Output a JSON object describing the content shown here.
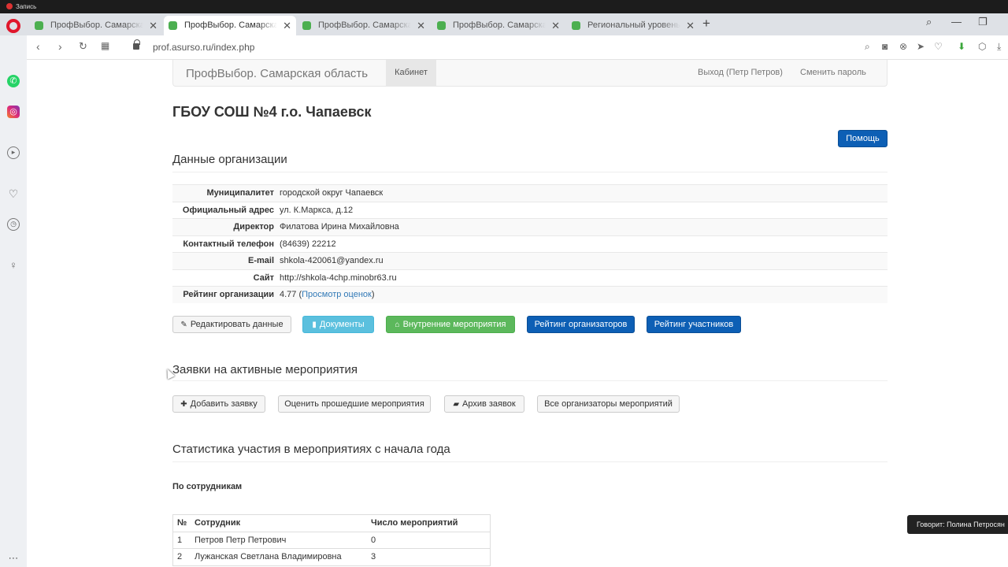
{
  "recording": {
    "label": "Запись"
  },
  "browser": {
    "tabs": [
      {
        "title": "ПрофВыбор. Самарская о",
        "active": false
      },
      {
        "title": "ПрофВыбор. Самарская о",
        "active": true
      },
      {
        "title": "ПрофВыбор. Самарская о",
        "active": false
      },
      {
        "title": "ПрофВыбор. Самарская о",
        "active": false
      },
      {
        "title": "Региональный уровень",
        "active": false
      }
    ],
    "new_tab": "+",
    "url": "prof.asurso.ru/index.php"
  },
  "site": {
    "brand": "ПрофВыбор. Самарская область",
    "nav_cabinet": "Кабинет",
    "logout": "Выход (Петр Петров)",
    "change_password": "Сменить пароль"
  },
  "org": {
    "title": "ГБОУ СОШ №4 г.о. Чапаевск",
    "help_button": "Помощь",
    "section_title": "Данные организации",
    "fields": [
      {
        "label": "Муниципалитет",
        "value": "городской округ Чапаевск"
      },
      {
        "label": "Официальный адрес",
        "value": "ул. К.Маркса, д.12"
      },
      {
        "label": "Директор",
        "value": "Филатова Ирина Михайловна"
      },
      {
        "label": "Контактный телефон",
        "value": "(84639) 22212"
      },
      {
        "label": "E-mail",
        "value": "shkola-420061@yandex.ru"
      },
      {
        "label": "Сайт",
        "value": "http://shkola-4chp.minobr63.ru"
      },
      {
        "label": "Рейтинг организации",
        "value": "4.77 (",
        "link": "Просмотр оценок",
        "suffix": ")"
      }
    ],
    "actions": {
      "edit": "Редактировать данные",
      "documents": "Документы",
      "internal_events": "Внутренние мероприятия",
      "organizers_rating": "Рейтинг организаторов",
      "participants_rating": "Рейтинг участников"
    }
  },
  "requests": {
    "title": "Заявки на активные мероприятия",
    "add": "Добавить заявку",
    "evaluate": "Оценить прошедшие мероприятия",
    "archive": "Архив заявок",
    "all_organizers": "Все организаторы мероприятий"
  },
  "stats": {
    "title": "Статистика участия в мероприятиях с начала года",
    "subtitle": "По сотрудникам",
    "columns": [
      "№",
      "Сотрудник",
      "Число мероприятий"
    ],
    "rows": [
      [
        "1",
        "Петров Петр Петрович",
        "0"
      ],
      [
        "2",
        "Лужанская Светлана Владимировна",
        "3"
      ]
    ]
  },
  "toast": "Говорит: Полина Петросян"
}
